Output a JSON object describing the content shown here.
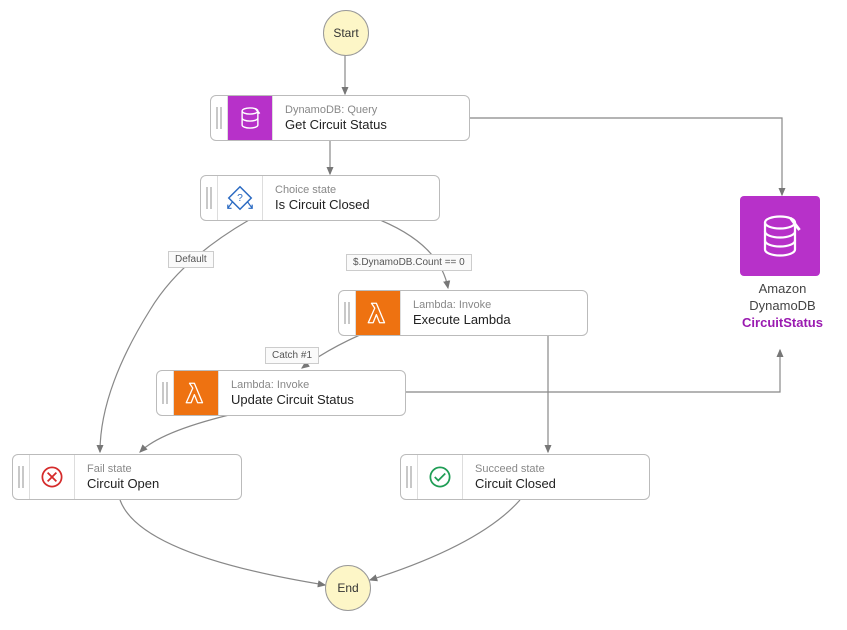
{
  "start_label": "Start",
  "end_label": "End",
  "nodes": {
    "get": {
      "sub": "DynamoDB: Query",
      "title": "Get Circuit Status"
    },
    "choice": {
      "sub": "Choice state",
      "title": "Is Circuit Closed"
    },
    "exec": {
      "sub": "Lambda: Invoke",
      "title": "Execute Lambda"
    },
    "update": {
      "sub": "Lambda: Invoke",
      "title": "Update Circuit Status"
    },
    "open": {
      "sub": "Fail state",
      "title": "Circuit Open"
    },
    "closed": {
      "sub": "Succeed state",
      "title": "Circuit Closed"
    }
  },
  "edge_labels": {
    "default": "Default",
    "cond": "$.DynamoDB.Count == 0",
    "catch": "Catch #1"
  },
  "external": {
    "line1": "Amazon",
    "line2": "DynamoDB",
    "line3": "CircuitStatus"
  }
}
